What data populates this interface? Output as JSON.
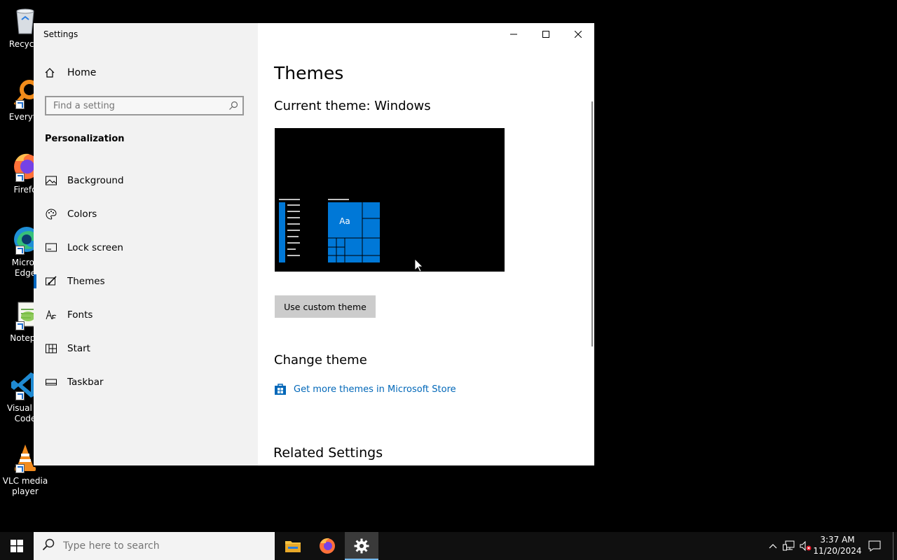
{
  "desktop": {
    "icons": [
      {
        "name": "recycle-bin",
        "label": "Recycle"
      },
      {
        "name": "everything",
        "label": "Everyth"
      },
      {
        "name": "firefox",
        "label": "Firefo"
      },
      {
        "name": "microsoft-edge",
        "label": "Micros Edge"
      },
      {
        "name": "notepad-plus-plus",
        "label": "Notepa"
      },
      {
        "name": "visual-studio-code",
        "label": "Visual St Code"
      },
      {
        "name": "vlc-media-player",
        "label": "VLC media player"
      }
    ]
  },
  "window": {
    "title": "Settings",
    "controls": {
      "minimize": "minimize-icon",
      "maximize": "maximize-icon",
      "close": "close-icon"
    }
  },
  "sidebar": {
    "home_label": "Home",
    "search_placeholder": "Find a setting",
    "section_title": "Personalization",
    "items": [
      {
        "label": "Background",
        "icon": "image-icon",
        "active": false
      },
      {
        "label": "Colors",
        "icon": "palette-icon",
        "active": false
      },
      {
        "label": "Lock screen",
        "icon": "lock-screen-icon",
        "active": false
      },
      {
        "label": "Themes",
        "icon": "brush-icon",
        "active": true
      },
      {
        "label": "Fonts",
        "icon": "font-icon",
        "active": false
      },
      {
        "label": "Start",
        "icon": "start-icon",
        "active": false
      },
      {
        "label": "Taskbar",
        "icon": "taskbar-icon",
        "active": false
      }
    ]
  },
  "main": {
    "title": "Themes",
    "current_theme": "Current theme: Windows",
    "preview_tile_label": "Aa",
    "custom_theme_button": "Use custom theme",
    "change_theme_title": "Change theme",
    "store_link": "Get more themes in Microsoft Store",
    "related_title": "Related Settings"
  },
  "taskbar": {
    "search_placeholder": "Type here to search",
    "pinned": [
      "file-explorer-icon",
      "firefox-icon",
      "settings-icon"
    ],
    "active_app": "settings-icon",
    "clock": {
      "time": "3:37 AM",
      "date": "11/20/2024"
    }
  },
  "colors": {
    "accent": "#0078d7",
    "link": "#0067b8",
    "sidebar_bg": "#f2f2f2",
    "taskbar_bg": "#101010"
  }
}
